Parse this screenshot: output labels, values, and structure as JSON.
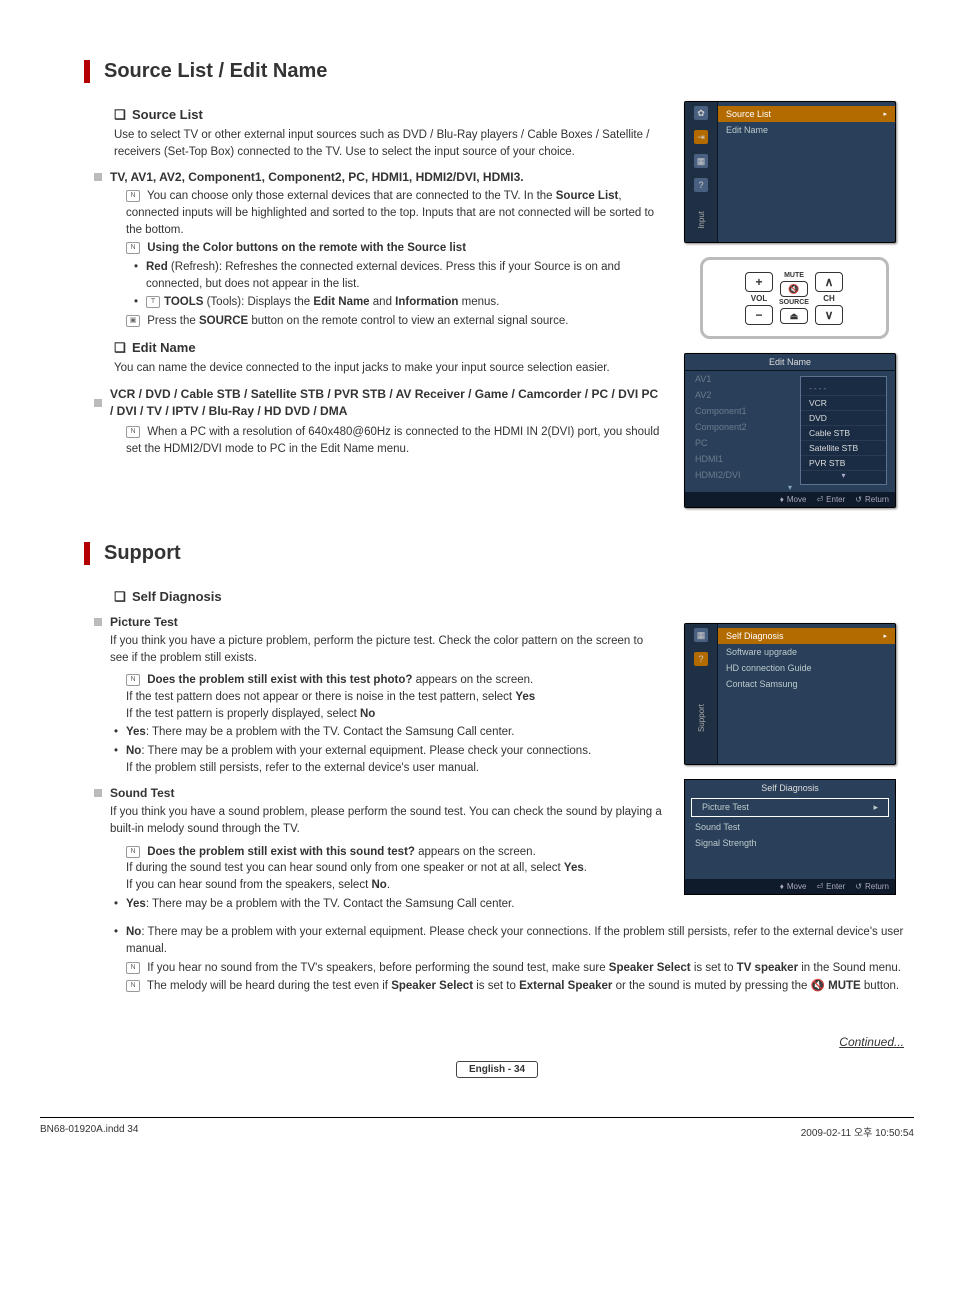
{
  "section1": {
    "title": "Source List / Edit Name",
    "source_list": {
      "heading": "Source List",
      "desc": "Use to select TV or other external input sources such as DVD / Blu-Ray players / Cable Boxes / Satellite / receivers (Set-Top Box) connected to the TV. Use to select the input source of your choice.",
      "inputs_head": "TV, AV1, AV2, Component1, Component2, PC, HDMI1, HDMI2/DVI, HDMI3.",
      "note1a": "You can choose only those external devices that are connected to the TV. In the ",
      "note1b": "Source List",
      "note1c": ", connected inputs will be highlighted and sorted to the top. Inputs that are not connected will be sorted to the bottom.",
      "color_head": "Using the Color buttons on the remote with the Source list",
      "red_label": "Red",
      "red_desc": " (Refresh): Refreshes the connected external devices. Press this if your Source is on and connected, but does not appear in the list.",
      "tools_label": "TOOLS",
      "tools_desc": " (Tools): Displays the ",
      "tools_b1": "Edit Name",
      "tools_mid": " and ",
      "tools_b2": "Information",
      "tools_end": " menus.",
      "press_a": "Press the ",
      "press_b": "SOURCE",
      "press_c": " button on the remote control to view an external signal source."
    },
    "edit_name": {
      "heading": "Edit Name",
      "desc": "You can name the device connected to the input jacks to make your input source selection easier.",
      "list_head": "VCR / DVD / Cable STB / Satellite STB / PVR STB / AV Receiver / Game / Camcorder / PC / DVI PC / DVI / TV / IPTV / Blu-Ray / HD DVD / DMA",
      "note": "When a PC with a resolution of 640x480@60Hz is connected to the HDMI IN 2(DVI) port, you should set the HDMI2/DVI mode to PC in the Edit Name menu."
    }
  },
  "osd_input": {
    "side_label": "Input",
    "items": [
      "Source List",
      "Edit Name"
    ]
  },
  "remote": {
    "vol": "VOL",
    "mute": "MUTE",
    "source": "SOURCE",
    "ch": "CH"
  },
  "osd_editname": {
    "title": "Edit Name",
    "rows": [
      "AV1",
      "AV2",
      "Component1",
      "Component2",
      "PC",
      "HDMI1",
      "HDMI2/DVI"
    ],
    "popup": [
      "----",
      "VCR",
      "DVD",
      "Cable STB",
      "Satellite STB",
      "PVR STB"
    ],
    "footer": {
      "move": "Move",
      "enter": "Enter",
      "return": "Return"
    }
  },
  "section2": {
    "title": "Support",
    "self_diag_head": "Self Diagnosis",
    "pic_test_head": "Picture Test",
    "pic_desc": "If you think you have a picture problem, perform the picture test. Check the color pattern on the screen to see if the problem still exists.",
    "pic_q": "Does the problem still exist with this test photo?",
    "pic_q_after": " appears on the screen.",
    "pic_q_sub1a": "If the test pattern does not appear or there is noise in the test pattern, select ",
    "pic_q_sub1b": "Yes",
    "pic_q_sub2a": "If the test pattern is properly displayed, select ",
    "pic_q_sub2b": "No",
    "yes_label": "Yes",
    "pic_yes": ": There may be a problem with the TV. Contact the Samsung Call center.",
    "no_label": "No",
    "pic_no": ": There may be a problem with your external equipment. Please check your connections.",
    "pic_no2": "If the problem still persists, refer to the external device's user manual.",
    "sound_head": "Sound Test",
    "sound_desc": "If you think you have a sound problem, please perform the sound test. You can check the sound by playing a built-in melody sound through the TV.",
    "sound_q": "Does the problem still exist with this sound test?",
    "sound_q_after": " appears on the screen.",
    "sound_sub1a": "If during the sound test you can hear sound only from one speaker or not at all, select ",
    "sound_sub1b": "Yes",
    "sound_sub1c": ".",
    "sound_sub2a": "If you can hear sound from the speakers, select ",
    "sound_sub2b": "No",
    "sound_sub2c": ".",
    "sound_yes": ": There may be a problem with the TV. Contact the Samsung Call center.",
    "sound_no": ": There may be a problem with your external equipment. Please check your connections. If the problem still persists, refer to the external device's user manual.",
    "spk_a": "If you hear no sound from the TV's speakers, before performing the sound test, make sure ",
    "spk_b": "Speaker Select",
    "spk_c": " is set to ",
    "spk_d": "TV speaker",
    "spk_e": " in the Sound menu.",
    "mel_a": "The melody will be heard during the test even if ",
    "mel_b": "Speaker Select",
    "mel_c": " is set to ",
    "mel_d": "External Speaker",
    "mel_e": " or the sound is muted by pressing the ",
    "mel_f": "MUTE",
    "mel_g": " button."
  },
  "osd_support": {
    "side_label": "Support",
    "items": [
      "Self Diagnosis",
      "Software upgrade",
      "HD connection Guide",
      "Contact Samsung"
    ]
  },
  "osd_selfdiag": {
    "title": "Self Diagnosis",
    "rows": [
      "Picture Test",
      "Sound Test",
      "Signal Strength"
    ],
    "footer": {
      "move": "Move",
      "enter": "Enter",
      "return": "Return"
    }
  },
  "continued": "Continued...",
  "page_foot": "English - 34",
  "bottom": {
    "left": "BN68-01920A.indd   34",
    "right": "2009-02-11   오후 10:50:54"
  }
}
